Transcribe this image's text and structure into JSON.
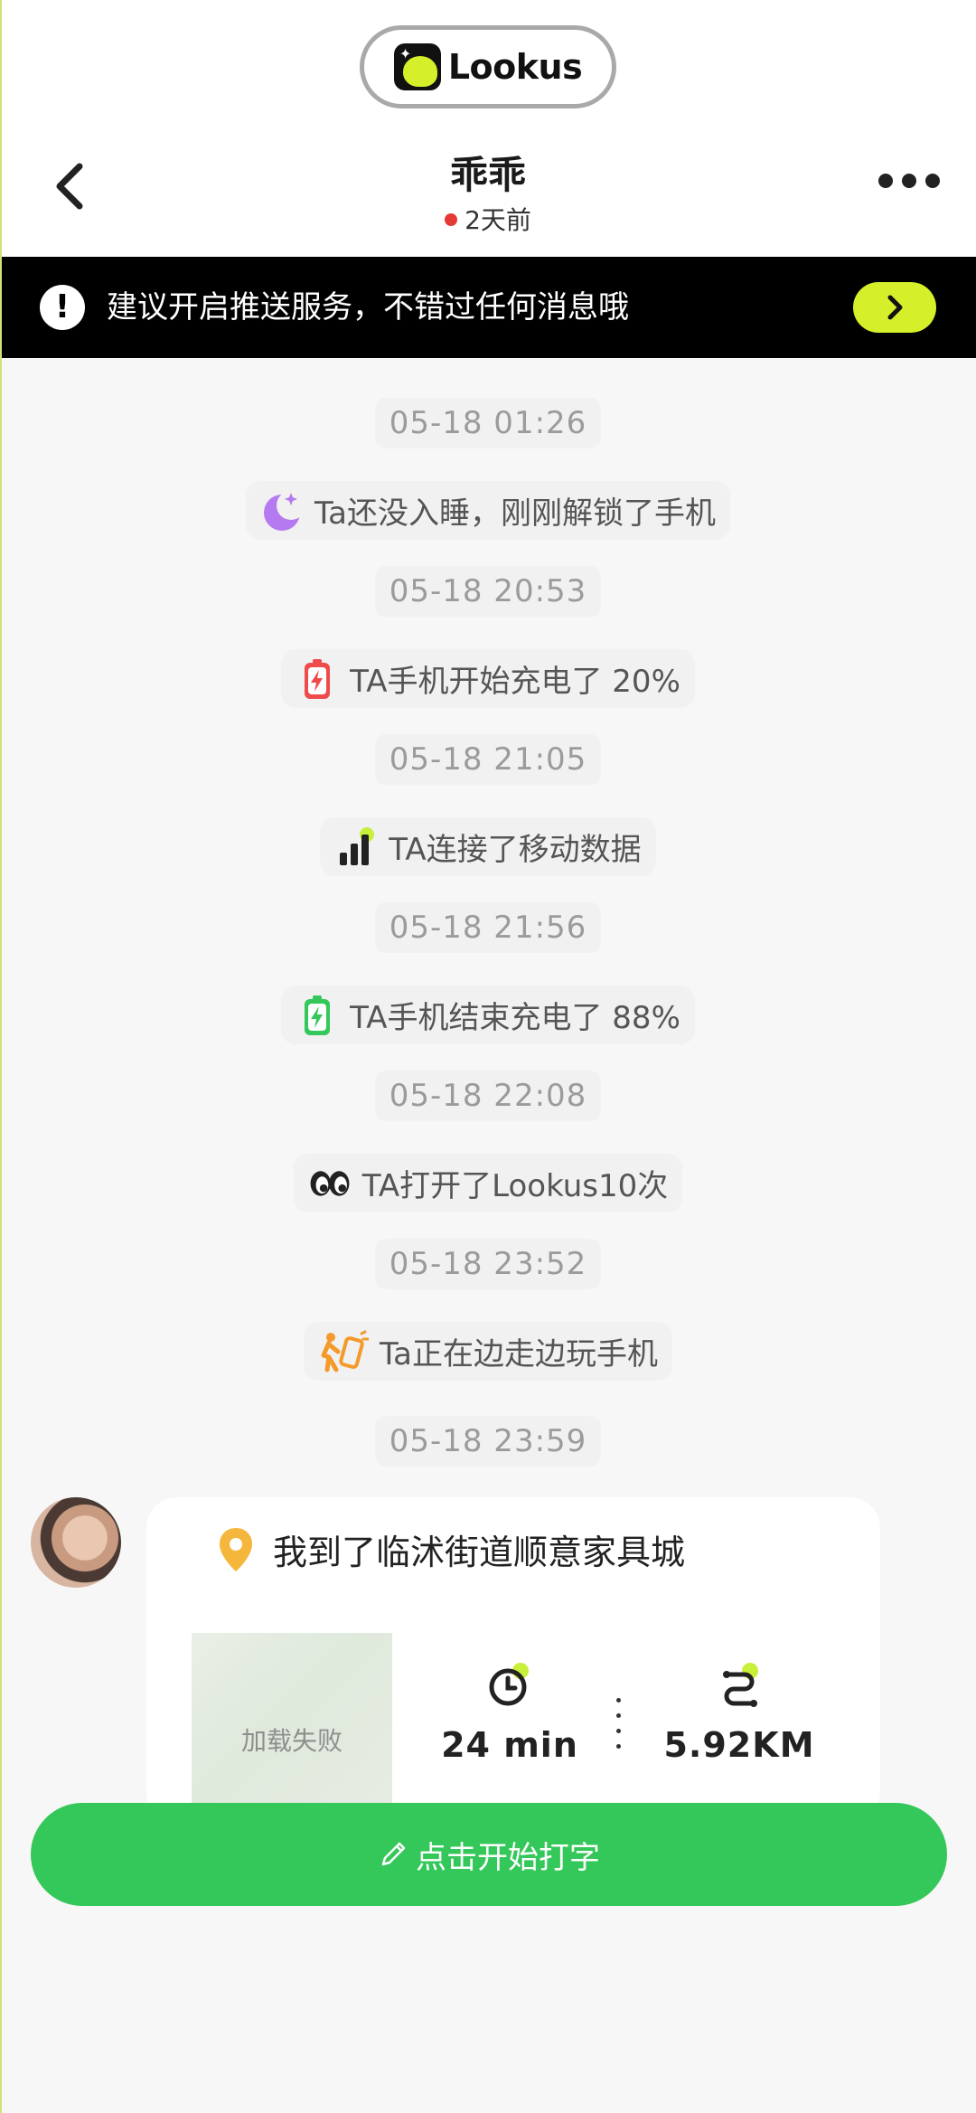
{
  "app": {
    "name": "Lookus"
  },
  "header": {
    "title": "乖乖",
    "status": "2天前"
  },
  "banner": {
    "text": "建议开启推送服务，不错过任何消息哦"
  },
  "feed": [
    {
      "time": "05-18 01:26",
      "icon": "moon-icon",
      "text": "Ta还没入睡，刚刚解锁了手机"
    },
    {
      "time": "05-18 20:53",
      "icon": "battery-charging-icon",
      "text": "TA手机开始充电了 20%"
    },
    {
      "time": "05-18 21:05",
      "icon": "signal-bars-icon",
      "text": "TA连接了移动数据"
    },
    {
      "time": "05-18 21:56",
      "icon": "battery-full-icon",
      "text": "TA手机结束充电了 88%"
    },
    {
      "time": "05-18 22:08",
      "icon": "eyes-icon",
      "text": "TA打开了Lookus10次"
    },
    {
      "time": "05-18 23:52",
      "icon": "walking-phone-icon",
      "text": "Ta正在边走边玩手机"
    },
    {
      "time": "05-18 23:59"
    }
  ],
  "location_card": {
    "place": "我到了临沭街道顺意家具城",
    "map_status": "加载失败",
    "duration": "24 min",
    "distance": "5.92KM"
  },
  "input": {
    "label": "点击开始打字"
  },
  "colors": {
    "accent_green": "#34c759",
    "accent_lime": "#d5f02a",
    "banner_bg": "#000000",
    "status_dot": "#e53935"
  }
}
